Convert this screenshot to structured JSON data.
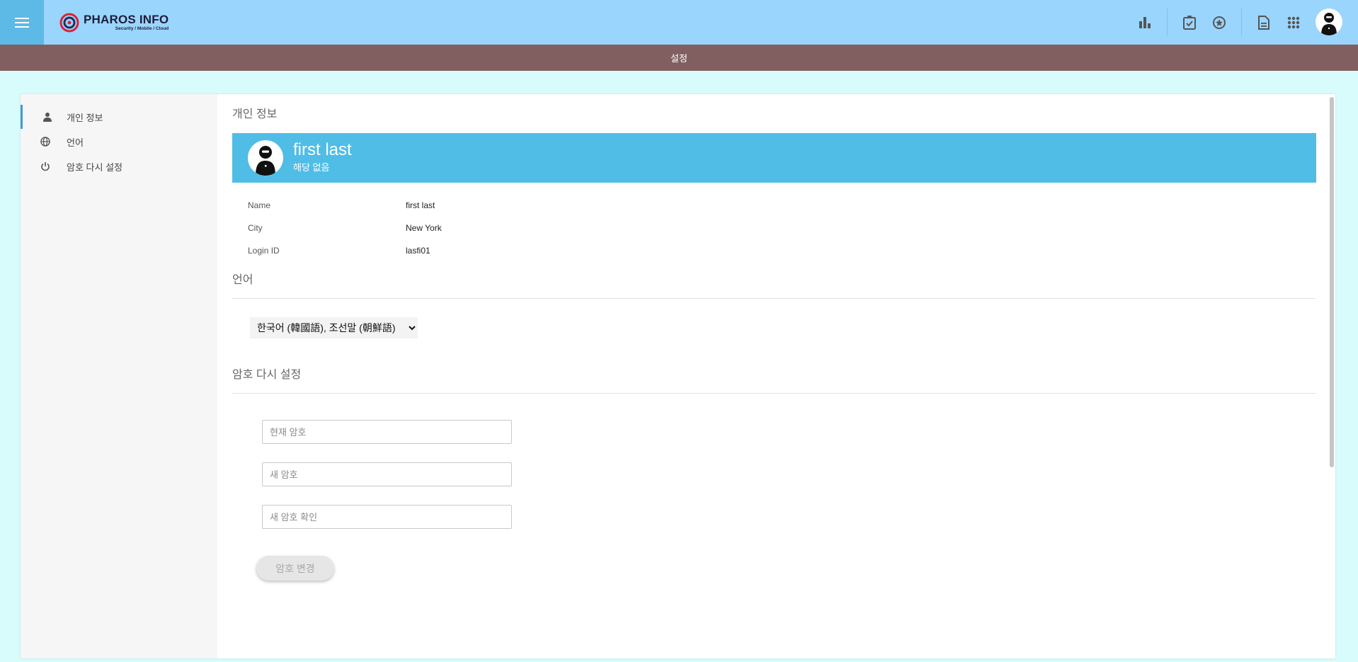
{
  "header": {
    "logo_main": "PHAROS INFO",
    "logo_sub": "Security / Mobile / Cloud",
    "page_title": "설정"
  },
  "sidebar": {
    "items": [
      {
        "label": "개인 정보",
        "icon": "person-icon"
      },
      {
        "label": "언어",
        "icon": "globe-icon"
      },
      {
        "label": "암호 다시 설정",
        "icon": "power-icon"
      }
    ]
  },
  "personal": {
    "section_title": "개인 정보",
    "name": "first last",
    "subtitle": "해당 없음",
    "rows": [
      {
        "key": "Name",
        "value": "first last"
      },
      {
        "key": "City",
        "value": "New York"
      },
      {
        "key": "Login ID",
        "value": "lasfi01"
      }
    ]
  },
  "language": {
    "section_title": "언어",
    "selected": "한국어 (韓國語), 조선말 (朝鮮語)"
  },
  "password": {
    "section_title": "암호 다시 설정",
    "current_placeholder": "현재 암호",
    "new_placeholder": "새 암호",
    "confirm_placeholder": "새 암호 확인",
    "button_label": "암호 변경"
  },
  "colors": {
    "topbar": "#9ad5fd",
    "menu_button": "#5db9e6",
    "title_strip": "#815f60",
    "banner": "#50bde7",
    "background": "#d8fbfb"
  }
}
